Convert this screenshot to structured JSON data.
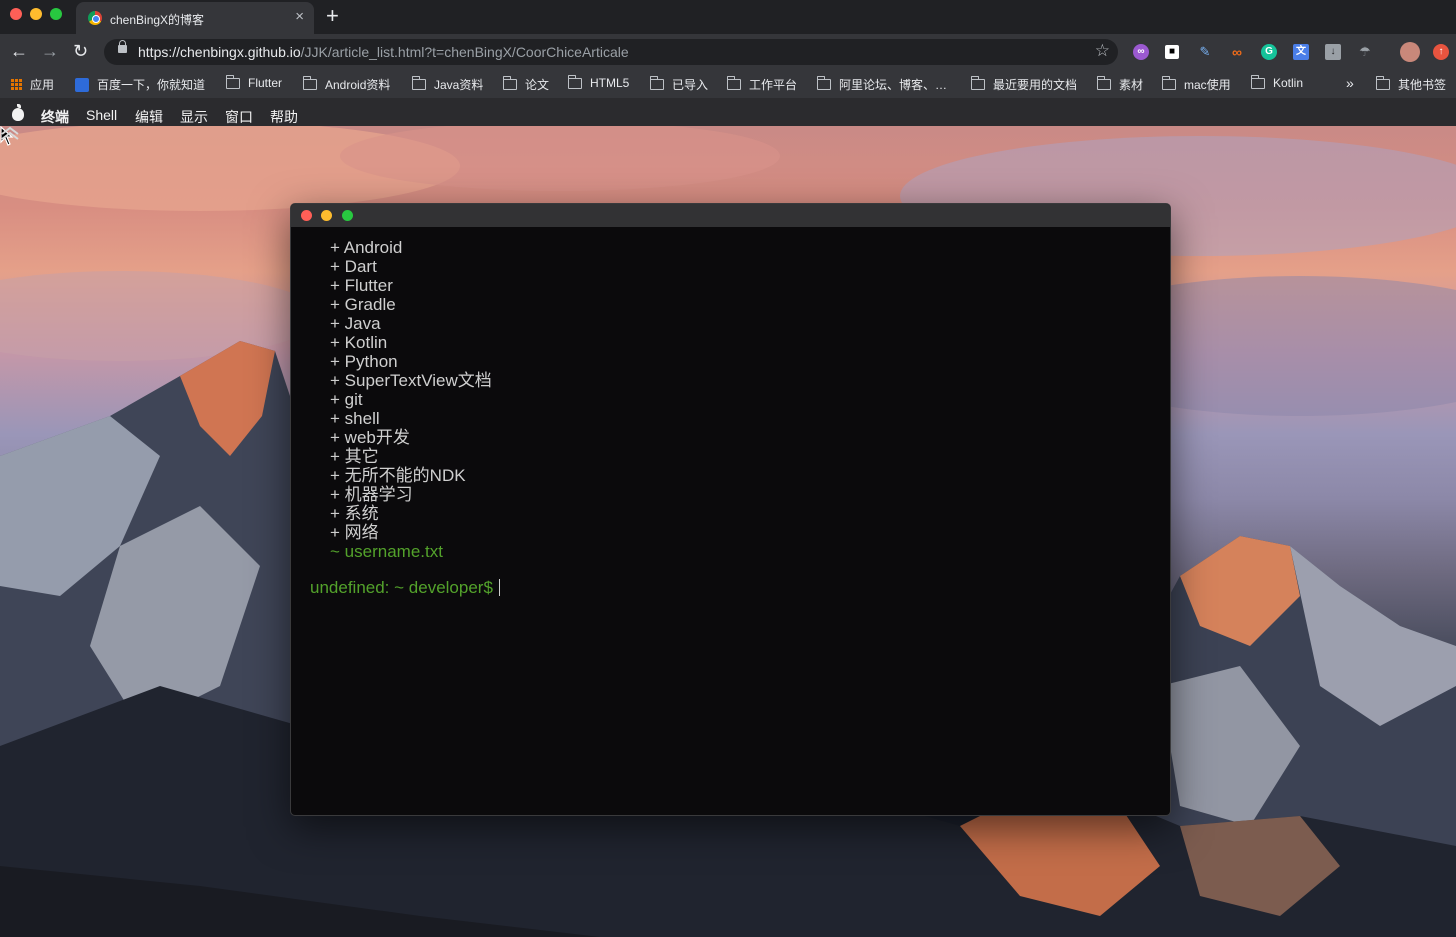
{
  "browser": {
    "tab": {
      "title": "chenBingX的博客",
      "close": "×"
    },
    "new_tab": "+",
    "url": {
      "host": "https://chenbingx.github.io",
      "path": "/JJK/article_list.html?t=chenBingX/CoorChiceArticale"
    },
    "extensions": [
      "purple-circle",
      "square",
      "pen",
      "infinity",
      "grammarly",
      "translate",
      "download",
      "umbrella",
      "avatar",
      "red-circle"
    ],
    "bookmarks": {
      "apps": "应用",
      "items": [
        "百度一下，你就知道",
        "Flutter",
        "Android资料",
        "Java资料",
        "论文",
        "HTML5",
        "已导入",
        "工作平台",
        "阿里论坛、博客、…",
        "最近要用的文档",
        "素材",
        "mac使用",
        "Kotlin"
      ],
      "overflow": "»",
      "other": "其他书签"
    }
  },
  "menubar": {
    "items": [
      "终端",
      "Shell",
      "编辑",
      "显示",
      "窗口",
      "帮助"
    ]
  },
  "terminal": {
    "dirs": [
      "Android",
      "Dart",
      "Flutter",
      "Gradle",
      "Java",
      "Kotlin",
      "Python",
      "SuperTextView文档",
      "git",
      "shell",
      "web开发",
      "其它",
      "无所不能的NDK",
      "机器学习",
      "系统",
      "网络"
    ],
    "dir_marker": "+",
    "file_marker": "~",
    "files": [
      "username.txt"
    ],
    "prompt": "undefined: ~ developer$"
  },
  "colors": {
    "terminal_bg": "#0b0a0c",
    "prompt_green": "#53a22b",
    "text": "#cfcfcf",
    "close": "#ff5f57",
    "minimize": "#febc2e",
    "zoom": "#28c840"
  }
}
